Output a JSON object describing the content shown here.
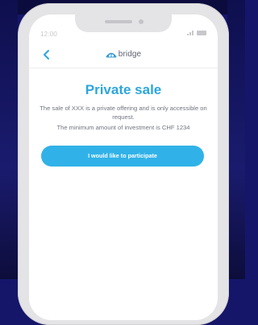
{
  "status_bar": {
    "time": "12:00"
  },
  "nav": {
    "back_icon": "chevron-left-icon",
    "logo_icon": "bridge-arch-logo",
    "logo_text": "bridge"
  },
  "content": {
    "title": "Private sale",
    "description": "The sale of XXX is a private offering and is only accessible on request.",
    "minimum_investment": "The minimum amount of investment is CHF 1234"
  },
  "cta": {
    "label": "I would like to participate"
  },
  "colors": {
    "accent": "#2ca6dd",
    "button": "#30b2e8",
    "background": "#15166a",
    "phone_frame": "#e4e4e6"
  }
}
